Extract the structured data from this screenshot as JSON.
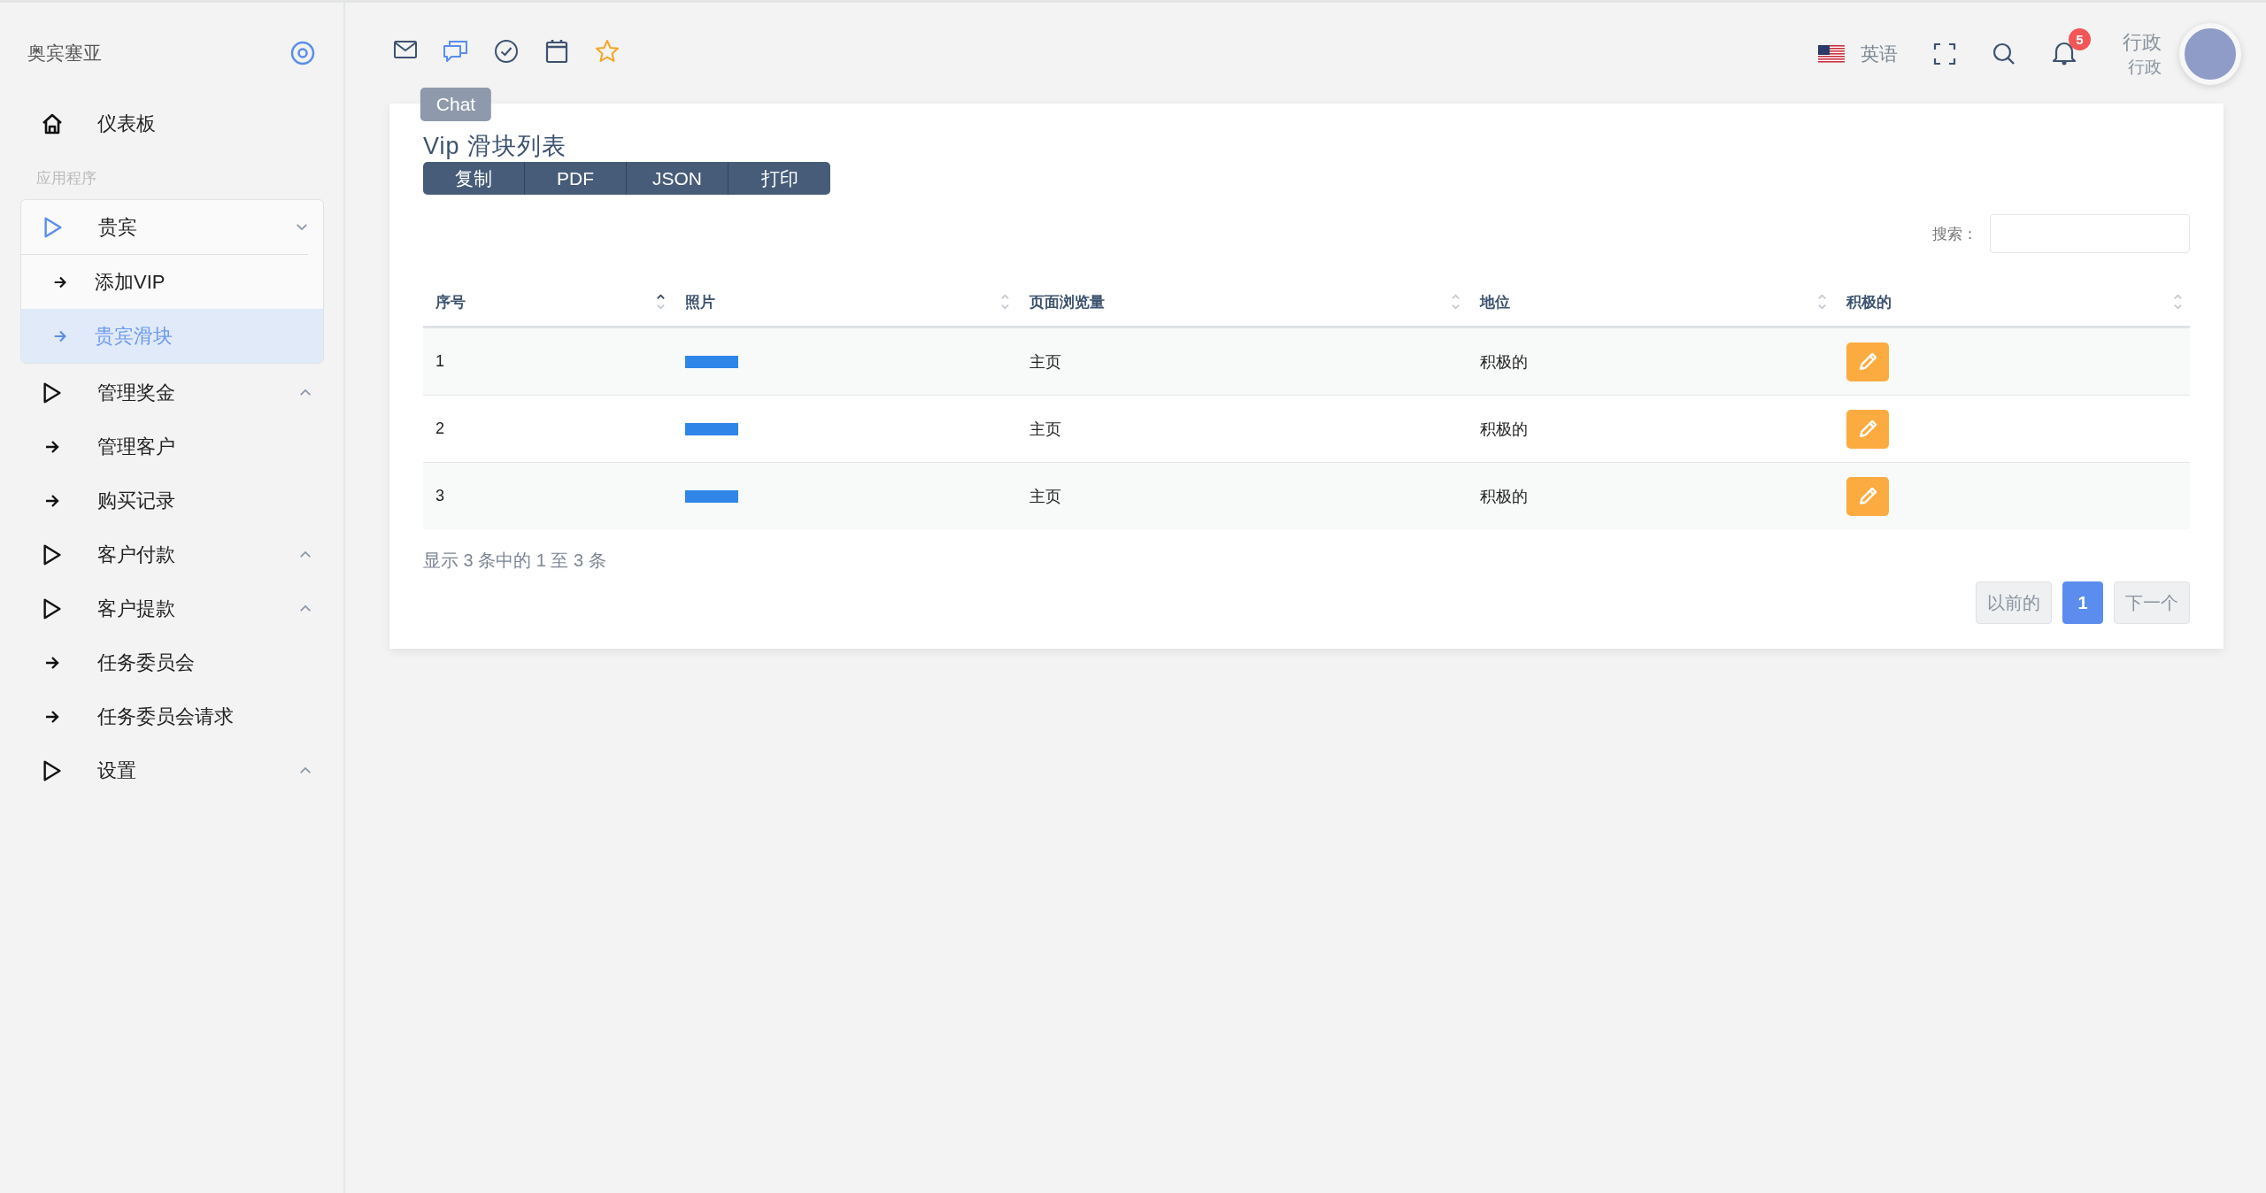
{
  "sidebar": {
    "brand": "奥宾塞亚",
    "dashboard": {
      "label": "仪表板"
    },
    "section_label": "应用程序",
    "items": [
      {
        "kind": "group",
        "label": "贵宾",
        "expanded": true,
        "children": [
          {
            "label": "添加VIP",
            "selected": false
          },
          {
            "label": "贵宾滑块",
            "selected": true
          }
        ]
      },
      {
        "kind": "group",
        "label": "管理奖金",
        "expanded": false
      },
      {
        "kind": "link",
        "label": "管理客户"
      },
      {
        "kind": "link",
        "label": "购买记录"
      },
      {
        "kind": "group",
        "label": "客户付款",
        "expanded": false
      },
      {
        "kind": "group",
        "label": "客户提款",
        "expanded": false
      },
      {
        "kind": "link",
        "label": "任务委员会"
      },
      {
        "kind": "link",
        "label": "任务委员会请求"
      },
      {
        "kind": "group",
        "label": "设置",
        "expanded": false
      }
    ]
  },
  "toolbar": {
    "tooltip": "Chat",
    "icons": [
      {
        "kind": "mail",
        "selected": false
      },
      {
        "kind": "chat",
        "selected": true
      },
      {
        "kind": "check",
        "selected": false
      },
      {
        "kind": "calendar",
        "selected": false
      },
      {
        "kind": "star",
        "selected": false
      }
    ]
  },
  "header": {
    "language": "英语",
    "notification_count": "5",
    "user_name": "行政",
    "user_role": "行政"
  },
  "card": {
    "title": "Vip 滑块列表",
    "export_buttons": [
      "复制",
      "PDF",
      "JSON",
      "打印"
    ],
    "search": {
      "label": "搜索："
    },
    "table": {
      "columns": [
        {
          "label": "序号",
          "sorted": true
        },
        {
          "label": "照片",
          "sorted": false
        },
        {
          "label": "页面浏览量",
          "sorted": false
        },
        {
          "label": "地位",
          "sorted": false
        },
        {
          "label": "积极的",
          "sorted": false
        }
      ],
      "rows": [
        {
          "index": "1",
          "page": "主页",
          "status": "积极的"
        },
        {
          "index": "2",
          "page": "主页",
          "status": "积极的"
        },
        {
          "index": "3",
          "page": "主页",
          "status": "积极的"
        }
      ]
    },
    "info": "显示 3 条中的 1 至 3 条",
    "pagination": {
      "previous": "以前的",
      "pages": [
        {
          "label": "1",
          "selected": true
        }
      ],
      "next": "下一个"
    }
  }
}
